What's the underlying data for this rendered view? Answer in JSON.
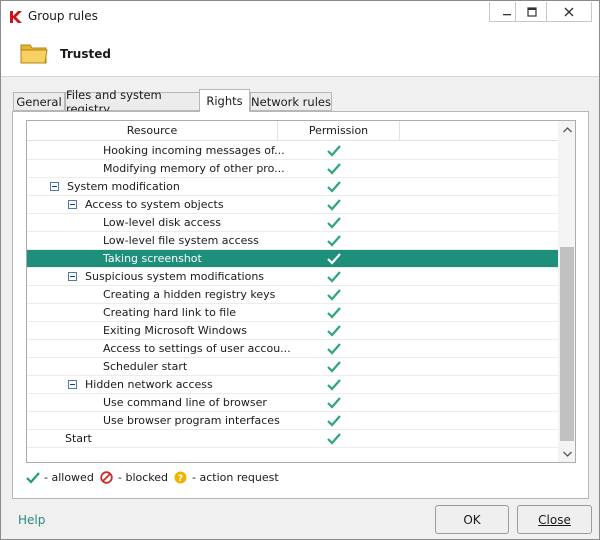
{
  "window": {
    "title": "Group rules"
  },
  "header": {
    "title": "Trusted",
    "icon": "folder-icon"
  },
  "tabs": [
    {
      "label": "General",
      "active": false
    },
    {
      "label": "Files and system registry",
      "active": false
    },
    {
      "label": "Rights",
      "active": true
    },
    {
      "label": "Network rules",
      "active": false
    }
  ],
  "table": {
    "columns": {
      "resource": "Resource",
      "permission": "Permission"
    },
    "rows": [
      {
        "label": "Hooking incoming messages of...",
        "indent": 3,
        "expander": false,
        "permission": "allowed"
      },
      {
        "label": "Modifying memory of other pro...",
        "indent": 3,
        "expander": false,
        "permission": "allowed"
      },
      {
        "label": "System modification",
        "indent": 1,
        "expander": true,
        "permission": "allowed"
      },
      {
        "label": "Access to system objects",
        "indent": 2,
        "expander": true,
        "permission": "allowed"
      },
      {
        "label": "Low-level disk access",
        "indent": 3,
        "expander": false,
        "permission": "allowed"
      },
      {
        "label": "Low-level file system access",
        "indent": 3,
        "expander": false,
        "permission": "allowed"
      },
      {
        "label": "Taking screenshot",
        "indent": 3,
        "expander": false,
        "permission": "allowed",
        "selected": true
      },
      {
        "label": "Suspicious system modifications",
        "indent": 2,
        "expander": true,
        "permission": "allowed"
      },
      {
        "label": "Creating a hidden registry keys",
        "indent": 3,
        "expander": false,
        "permission": "allowed"
      },
      {
        "label": "Creating hard link to file",
        "indent": 3,
        "expander": false,
        "permission": "allowed"
      },
      {
        "label": "Exiting Microsoft Windows",
        "indent": 3,
        "expander": false,
        "permission": "allowed"
      },
      {
        "label": "Access to settings of user accou...",
        "indent": 3,
        "expander": false,
        "permission": "allowed"
      },
      {
        "label": "Scheduler start",
        "indent": 3,
        "expander": false,
        "permission": "allowed"
      },
      {
        "label": "Hidden network access",
        "indent": 2,
        "expander": true,
        "permission": "allowed"
      },
      {
        "label": "Use command line of browser",
        "indent": 3,
        "expander": false,
        "permission": "allowed"
      },
      {
        "label": "Use browser program interfaces",
        "indent": 3,
        "expander": false,
        "permission": "allowed"
      },
      {
        "label": "Start",
        "indent": 0,
        "expander": false,
        "permission": "allowed"
      }
    ]
  },
  "legend": {
    "allowed": "- allowed",
    "blocked": "- blocked",
    "action_request": "- action request"
  },
  "footer": {
    "help": "Help",
    "ok": "OK",
    "close": "Close"
  },
  "colors": {
    "selection": "#1e8f7a",
    "check": "#2aa57c",
    "blocked": "#d12a2a",
    "request": "#f0b400",
    "help_link": "#2a8a7c"
  }
}
